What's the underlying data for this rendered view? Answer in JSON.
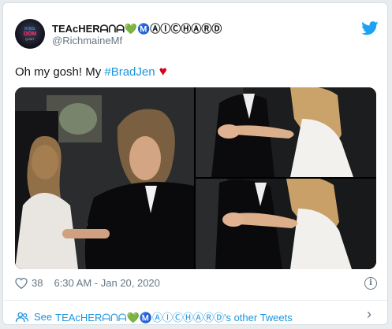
{
  "tweet": {
    "display_name": "TEAcHERᗩᑎᗩ💚Ⓜ️ⒶⒾⒸⒽⒶⓇⒹ",
    "handle": "@RichmaineMf",
    "text_plain": "Oh my gosh! My ",
    "hashtag": "#BradJen",
    "heart": "♥",
    "likes": "38",
    "timestamp": "6:30 AM - Jan 20, 2020",
    "info_glyph": "i"
  },
  "avatar": {
    "line1": "KING",
    "line2": "DOM",
    "line3": "QUIET"
  },
  "footer": {
    "see_label": "See",
    "other_tweets": "TEAcHERᗩᑎᗩ💚Ⓜ️ⒶⒾⒸⒽⒶⓇⒹ's other Tweets",
    "chevron": "›"
  },
  "colors": {
    "link": "#1b95e0",
    "muted": "#657786",
    "heart": "#d0021b",
    "twitter_blue": "#1da1f2"
  },
  "icons": [
    "twitter-bird-icon",
    "heart-outline-icon",
    "info-icon",
    "people-icon",
    "chevron-right-icon"
  ]
}
